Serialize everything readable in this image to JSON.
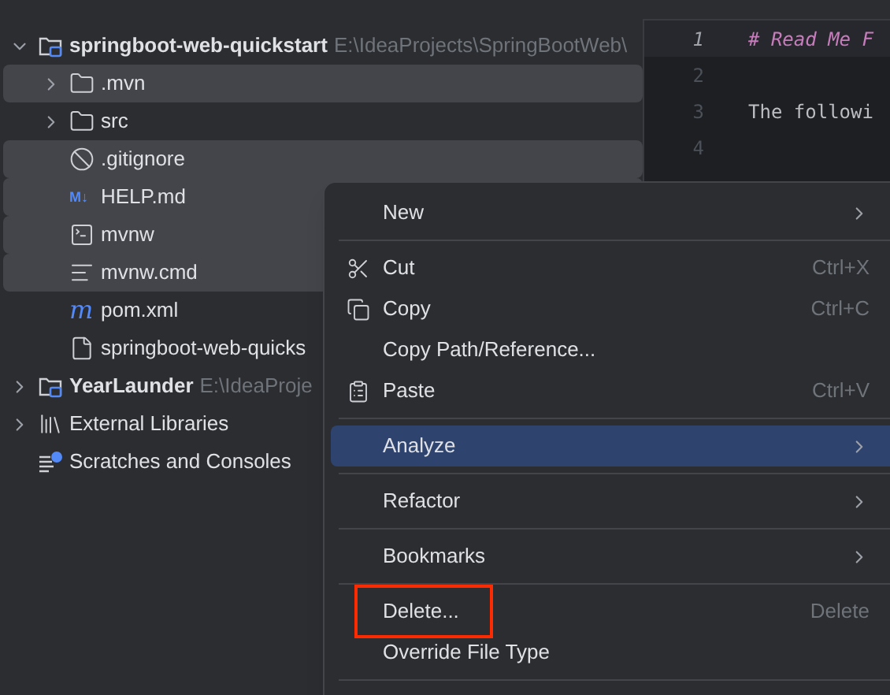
{
  "project_tree": [
    {
      "label": "springboot-web-quickstart",
      "path": "E:\\IdeaProjects\\SpringBootWeb\\",
      "kind": "module",
      "expanded": true,
      "selected": false,
      "children": [
        {
          "label": ".mvn",
          "kind": "folder",
          "expanded": false,
          "selected": true
        },
        {
          "label": "src",
          "kind": "folder",
          "expanded": false,
          "selected": false
        },
        {
          "label": ".gitignore",
          "kind": "ignore",
          "selected": true
        },
        {
          "label": "HELP.md",
          "kind": "markdown",
          "icon_text": "M↓",
          "selected": true
        },
        {
          "label": "mvnw",
          "kind": "terminal",
          "selected": true
        },
        {
          "label": "mvnw.cmd",
          "kind": "text",
          "selected": true
        },
        {
          "label": "pom.xml",
          "kind": "maven",
          "icon_text": "m",
          "selected": false
        },
        {
          "label": "springboot-web-quicks",
          "kind": "file",
          "selected": false
        }
      ]
    },
    {
      "label": "YearLaunder",
      "path": "E:\\IdeaProje",
      "kind": "module",
      "expanded": false,
      "selected": false
    },
    {
      "label": "External Libraries",
      "kind": "libraries",
      "expanded": false,
      "selected": false
    },
    {
      "label": "Scratches and Consoles",
      "kind": "scratches",
      "selected": false
    }
  ],
  "editor": {
    "lines": [
      {
        "number": "1",
        "text": "# Read Me F",
        "kind": "heading",
        "current": true
      },
      {
        "number": "2",
        "kind": "blank",
        "current": false
      },
      {
        "number": "3",
        "text": "The followi",
        "kind": "plain",
        "current": false
      },
      {
        "number": "4",
        "kind": "blank",
        "current": false
      }
    ]
  },
  "context_menu": [
    {
      "kind": "plain",
      "label": "New",
      "submenu": true,
      "selected": false
    },
    {
      "kind": "separator"
    },
    {
      "kind": "cut",
      "label": "Cut",
      "shortcut": "Ctrl+X",
      "selected": false
    },
    {
      "kind": "copy",
      "label": "Copy",
      "shortcut": "Ctrl+C",
      "selected": false
    },
    {
      "kind": "plain",
      "label": "Copy Path/Reference...",
      "selected": false
    },
    {
      "kind": "paste",
      "label": "Paste",
      "shortcut": "Ctrl+V",
      "selected": false
    },
    {
      "kind": "separator"
    },
    {
      "kind": "plain",
      "label": "Analyze",
      "submenu": true,
      "selected": true
    },
    {
      "kind": "separator"
    },
    {
      "kind": "plain",
      "label": "Refactor",
      "submenu": true,
      "selected": false
    },
    {
      "kind": "separator"
    },
    {
      "kind": "plain",
      "label": "Bookmarks",
      "submenu": true,
      "selected": false
    },
    {
      "kind": "separator"
    },
    {
      "kind": "plain",
      "label": "Delete...",
      "shortcut": "Delete",
      "selected": false,
      "highlighted": true
    },
    {
      "kind": "plain",
      "label": "Override File Type",
      "selected": false
    },
    {
      "kind": "separator"
    }
  ]
}
